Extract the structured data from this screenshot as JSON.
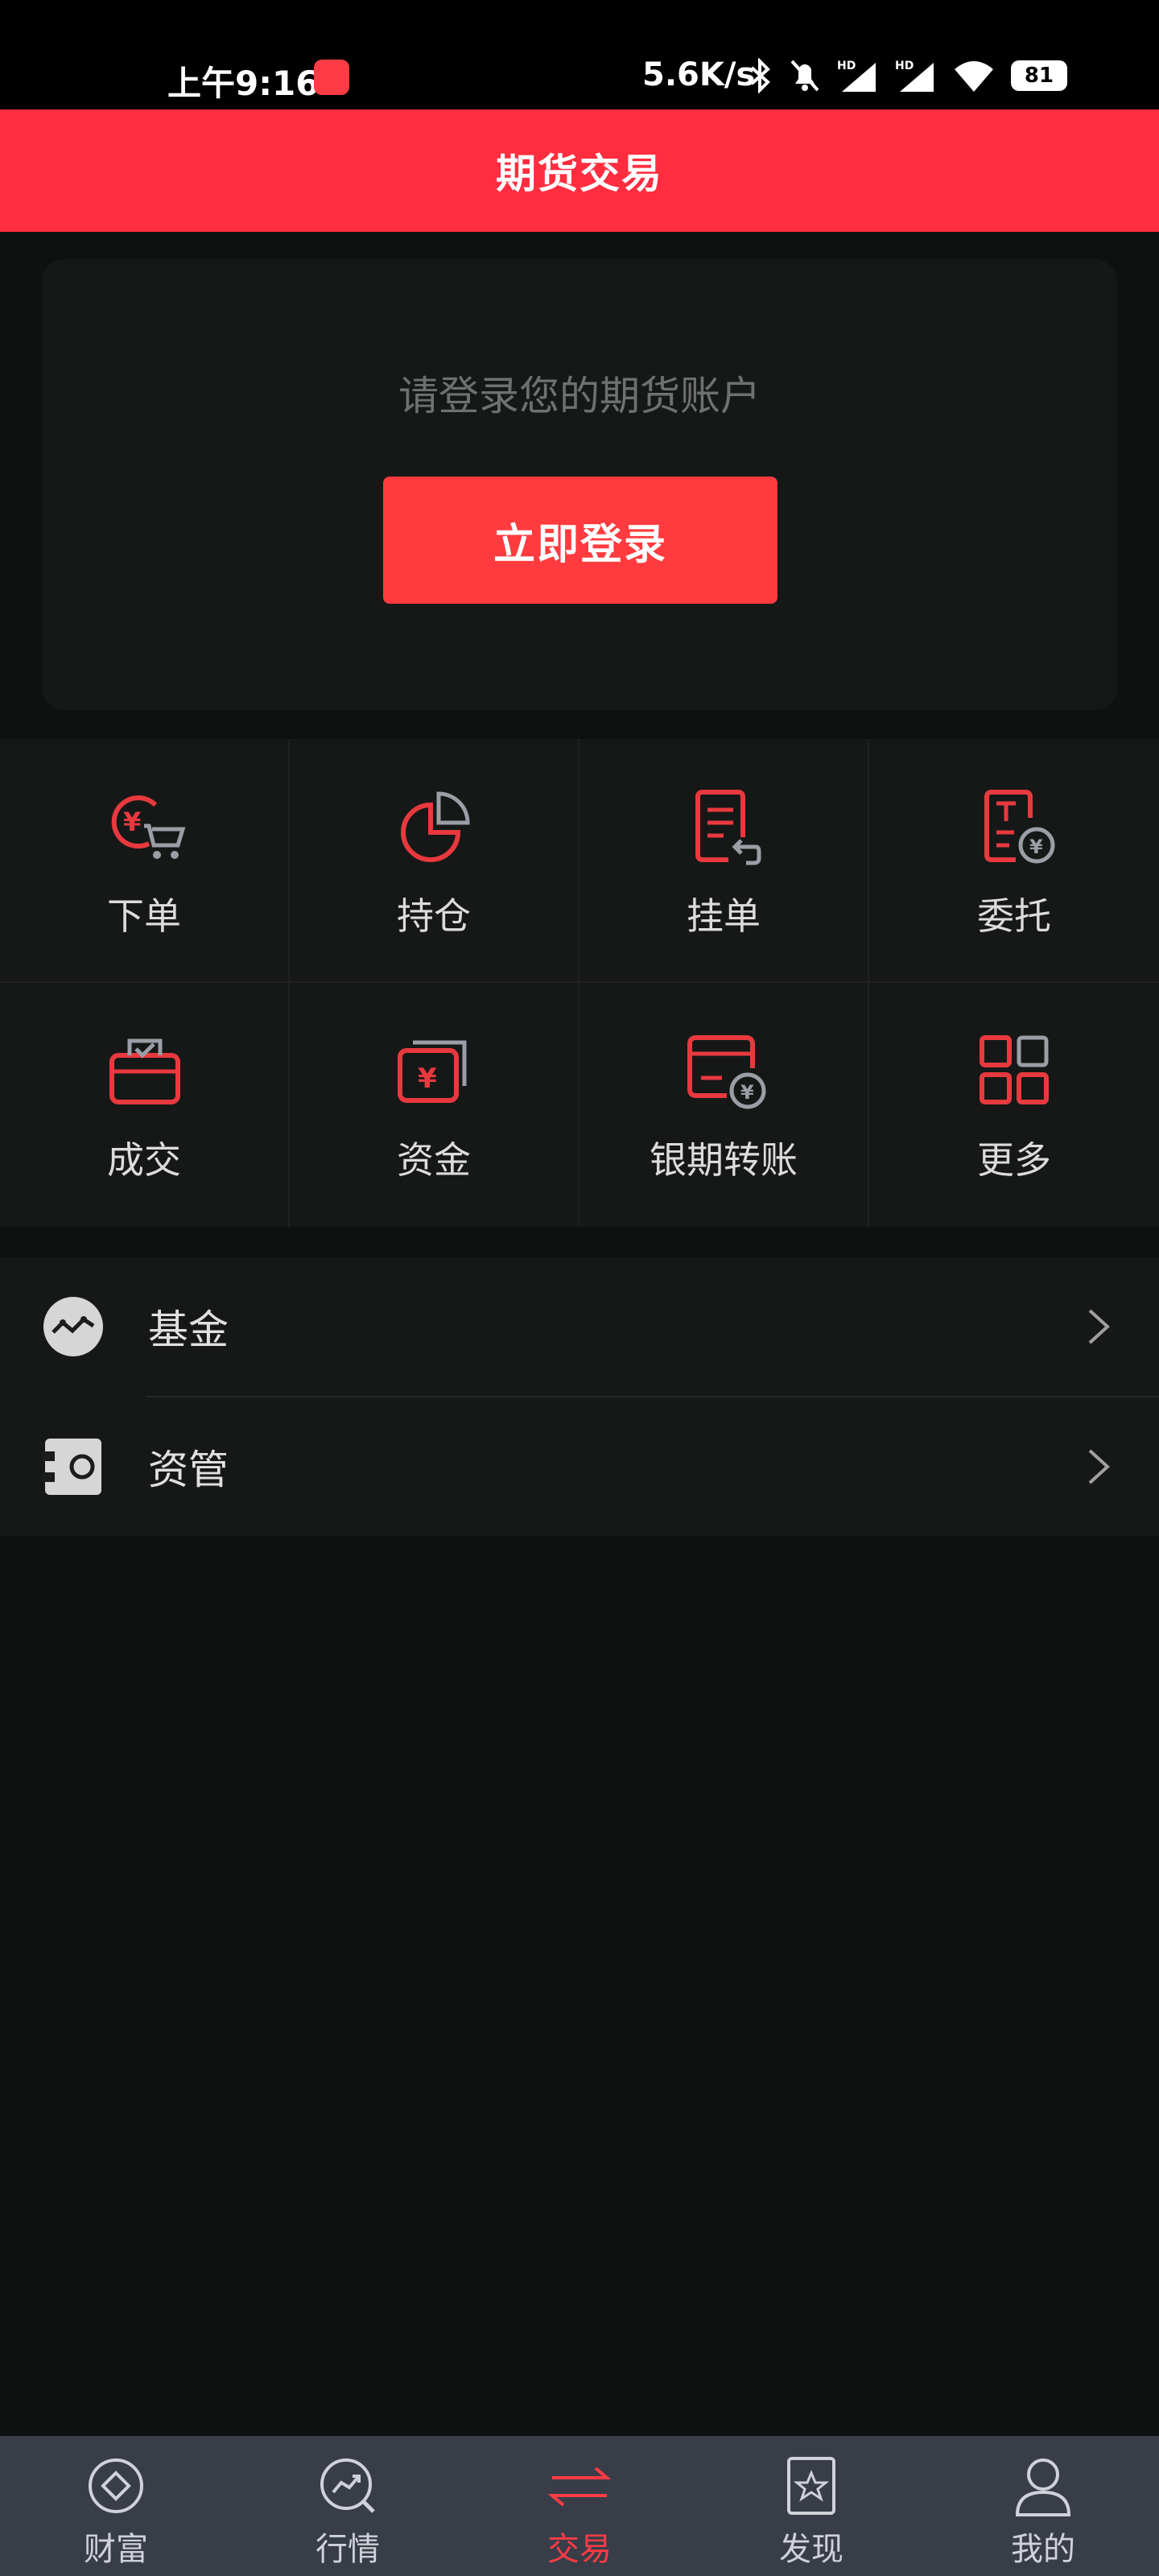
{
  "status_bar": {
    "time": "上午9:16",
    "network_speed": "5.6K/s",
    "battery": "81"
  },
  "header": {
    "title": "期货交易"
  },
  "login": {
    "prompt": "请登录您的期货账户",
    "button_label": "立即登录"
  },
  "grid": {
    "items": [
      {
        "label": "下单",
        "icon": "order-cart-icon"
      },
      {
        "label": "持仓",
        "icon": "position-pie-icon"
      },
      {
        "label": "挂单",
        "icon": "pending-order-icon"
      },
      {
        "label": "委托",
        "icon": "commission-icon"
      },
      {
        "label": "成交",
        "icon": "deal-bag-icon"
      },
      {
        "label": "资金",
        "icon": "funds-icon"
      },
      {
        "label": "银期转账",
        "icon": "bank-transfer-icon"
      },
      {
        "label": "更多",
        "icon": "more-grid-icon"
      }
    ]
  },
  "list": {
    "items": [
      {
        "label": "基金",
        "icon": "fund-icon"
      },
      {
        "label": "资管",
        "icon": "asset-management-icon"
      }
    ]
  },
  "bottom_nav": {
    "items": [
      {
        "label": "财富",
        "icon": "wealth-icon"
      },
      {
        "label": "行情",
        "icon": "market-icon"
      },
      {
        "label": "交易",
        "icon": "trade-icon",
        "active": true
      },
      {
        "label": "发现",
        "icon": "discover-icon"
      },
      {
        "label": "我的",
        "icon": "profile-icon"
      }
    ]
  },
  "colors": {
    "brand_red": "#ff2d3f",
    "button_red": "#ff3b3f",
    "background": "#0f1110",
    "card": "#161817",
    "nav_bg": "#383d48"
  }
}
